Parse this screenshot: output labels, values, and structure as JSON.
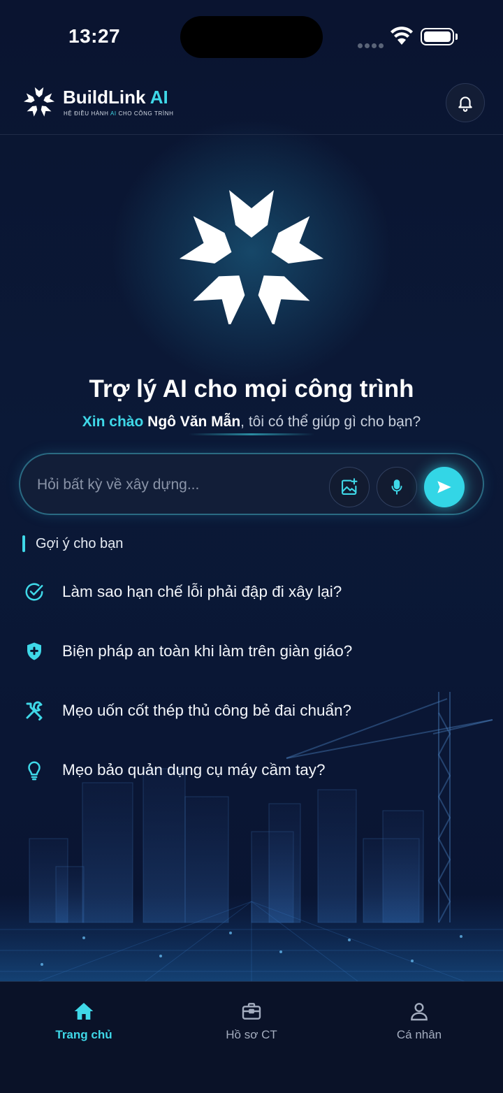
{
  "status_bar": {
    "time": "13:27"
  },
  "header": {
    "brand_name": "BuildLink",
    "brand_ai": "AI",
    "brand_sub_1": "HỆ ĐIỀU HÀNH",
    "brand_sub_ai": "AI",
    "brand_sub_2": "CHO CÔNG TRÌNH"
  },
  "hero": {
    "title": "Trợ lý AI cho mọi công trình",
    "greeting": "Xin chào",
    "user_name": "Ngô Văn Mẫn",
    "question": ", tôi có thể giúp gì cho bạn?"
  },
  "ask": {
    "placeholder": "Hỏi bất kỳ về xây dựng..."
  },
  "suggestions": {
    "heading": "Gợi ý cho bạn",
    "items": [
      {
        "icon": "check-circle-icon",
        "text": "Làm sao hạn chế lỗi phải đập đi xây lại?"
      },
      {
        "icon": "shield-plus-icon",
        "text": "Biện pháp an toàn khi làm trên giàn giáo?"
      },
      {
        "icon": "tools-icon",
        "text": "Mẹo uốn cốt thép thủ công bẻ đai chuẩn?"
      },
      {
        "icon": "lightbulb-icon",
        "text": "Mẹo bảo quản dụng cụ máy cầm tay?"
      }
    ]
  },
  "nav": {
    "items": [
      {
        "icon": "home-icon",
        "label": "Trang chủ",
        "active": true
      },
      {
        "icon": "briefcase-icon",
        "label": "Hồ sơ CT",
        "active": false
      },
      {
        "icon": "user-icon",
        "label": "Cá nhân",
        "active": false
      }
    ]
  },
  "colors": {
    "accent": "#3fd8e8",
    "background": "#0a1530",
    "nav_bg": "#0a1228"
  }
}
